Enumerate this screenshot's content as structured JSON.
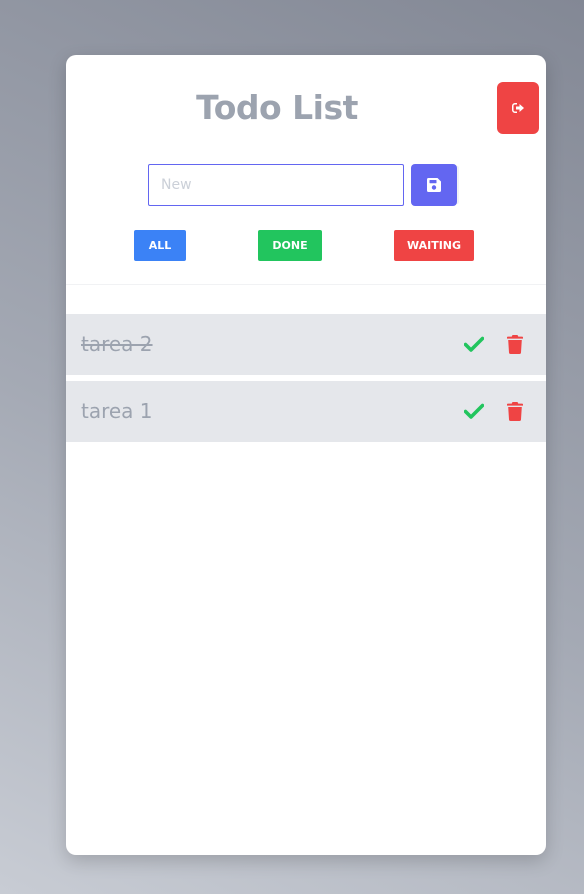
{
  "header": {
    "title": "Todo List",
    "logout_icon": "sign-out-icon"
  },
  "new_todo": {
    "placeholder": "New",
    "value": "",
    "save_icon": "floppy-disk-icon"
  },
  "filters": [
    {
      "label": "ALL",
      "color": "#3b82f6"
    },
    {
      "label": "DONE",
      "color": "#22c55e"
    },
    {
      "label": "WAITING",
      "color": "#ef4444"
    }
  ],
  "todos": [
    {
      "text": "tarea 2",
      "done": true,
      "check_icon": "check-icon",
      "delete_icon": "trash-icon"
    },
    {
      "text": "tarea 1",
      "done": false,
      "check_icon": "check-icon",
      "delete_icon": "trash-icon"
    }
  ],
  "colors": {
    "accent": "#6366f1",
    "danger": "#ef4444",
    "success": "#22c55e",
    "primary": "#3b82f6",
    "muted_text": "#9ca3af",
    "item_bg": "#e5e7eb"
  }
}
